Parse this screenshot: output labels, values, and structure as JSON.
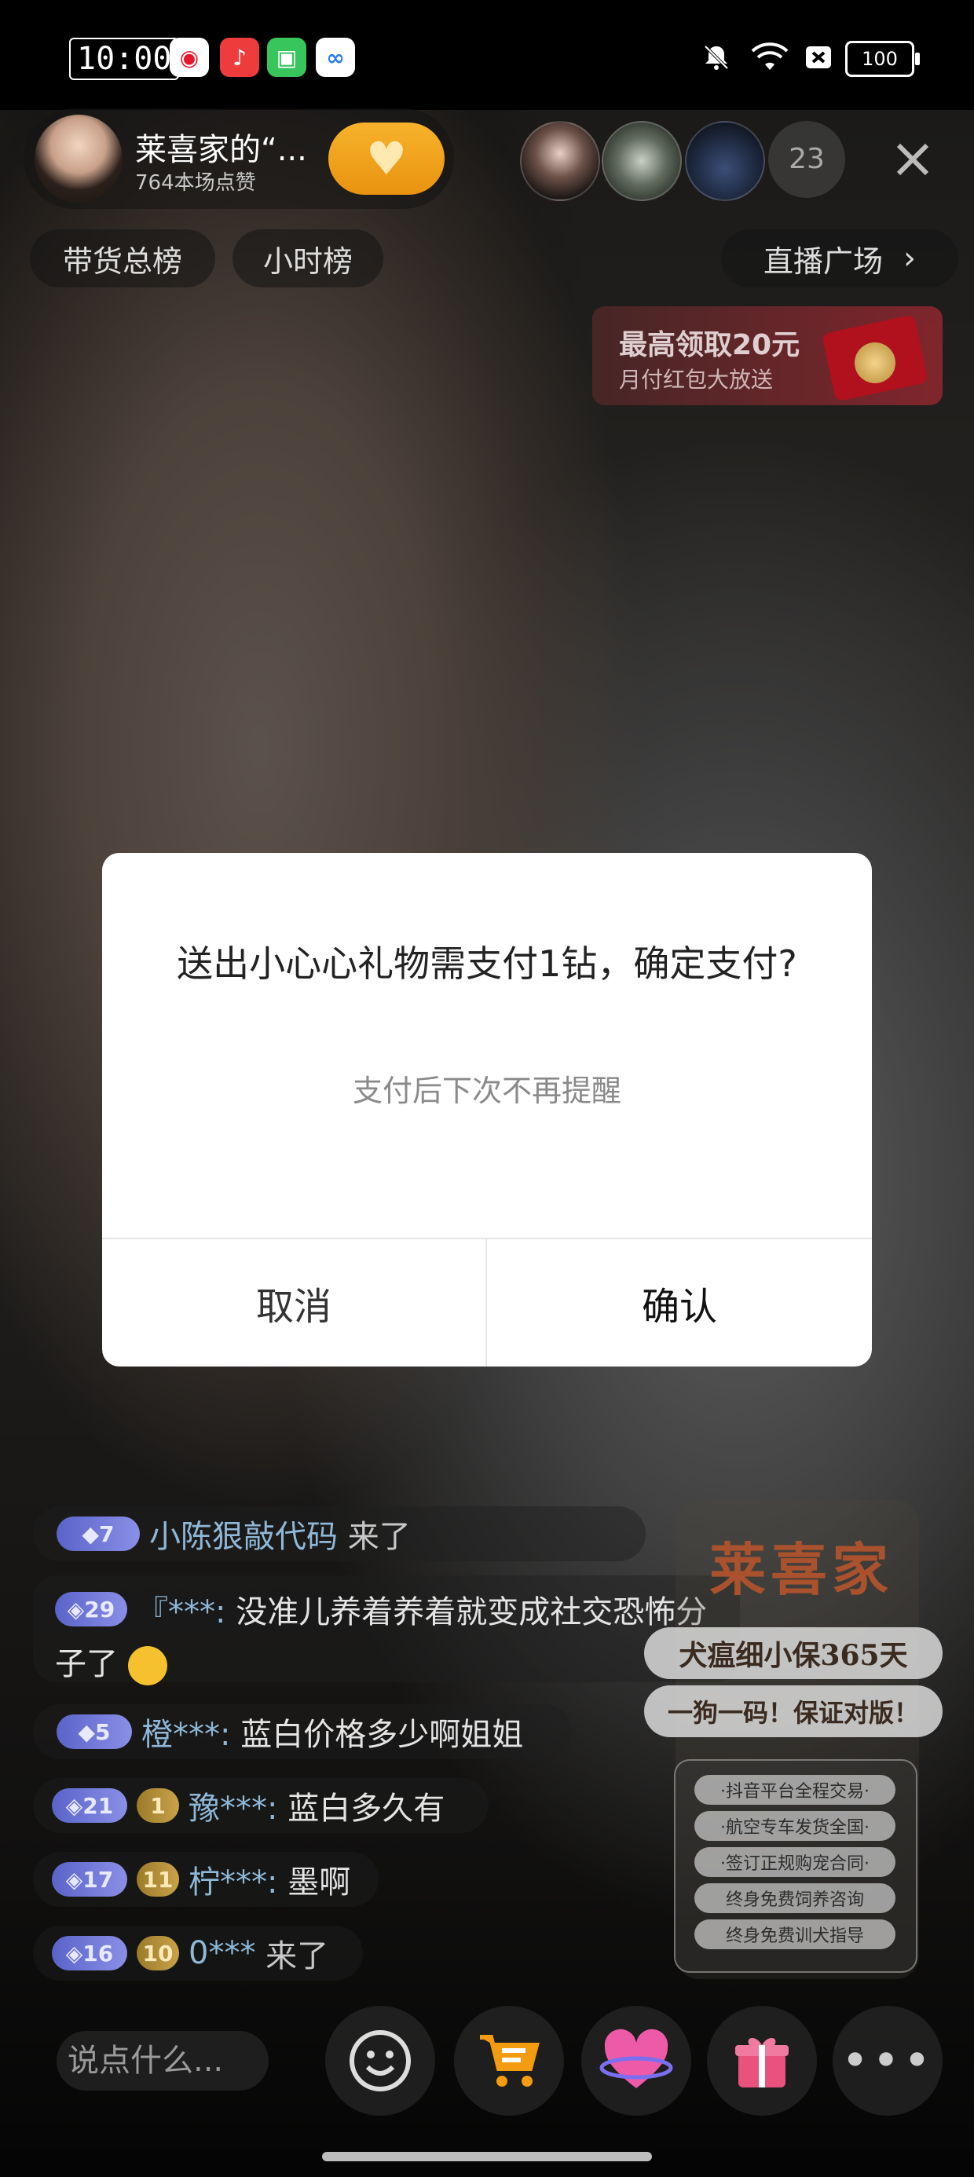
{
  "status_bar": {
    "time": "10:00",
    "battery": "100",
    "apps": [
      "weibo-icon",
      "music-icon",
      "market-icon",
      "cloud-icon"
    ],
    "icons": [
      "mute-icon",
      "wifi-icon",
      "sim-icon"
    ]
  },
  "host": {
    "name": "莱喜家的“...",
    "likes": "764本场点赞"
  },
  "viewers": {
    "count": "23"
  },
  "tabs": {
    "sales_rank": "带货总榜",
    "hour_rank": "小时榜",
    "live_square": "直播广场"
  },
  "promo": {
    "title": "最高领取20元",
    "subtitle": "月付红包大放送"
  },
  "dialog": {
    "title": "送出小心心礼物需支付1钻，确定支付?",
    "subtitle": "支付后下次不再提醒",
    "cancel": "取消",
    "confirm": "确认"
  },
  "chat": [
    {
      "level": "7",
      "user": "小陈狠敲代码",
      "text": "来了"
    },
    {
      "level": "29",
      "user": "『***:",
      "text": "没准儿养着养着就变成社交恐怖分",
      "text2": "子了"
    },
    {
      "level": "5",
      "user": "橙***:",
      "text": "蓝白价格多少啊姐姐"
    },
    {
      "level": "21",
      "fan": "1",
      "user": "豫***:",
      "text": "蓝白多久有"
    },
    {
      "level": "17",
      "fan": "11",
      "user": "柠***:",
      "text": "墨啊"
    },
    {
      "level": "16",
      "fan": "10",
      "user": "0***",
      "text": "来了"
    }
  ],
  "poster": {
    "logo": "莱喜家",
    "slogan1": "犬瘟细小保365天",
    "slogan2": "一狗一码！保证对版！",
    "features": [
      "·抖音平台全程交易·",
      "·航空专车发货全国·",
      "·签订正规购宠合同·",
      "终身免费饲养咨询",
      "终身免费训犬指导"
    ]
  },
  "bottom": {
    "input_placeholder": "说点什么..."
  },
  "colors": {
    "follow": "#f0a11d",
    "badge_purple": "#6c74d6",
    "badge_gold": "#b8923c"
  }
}
